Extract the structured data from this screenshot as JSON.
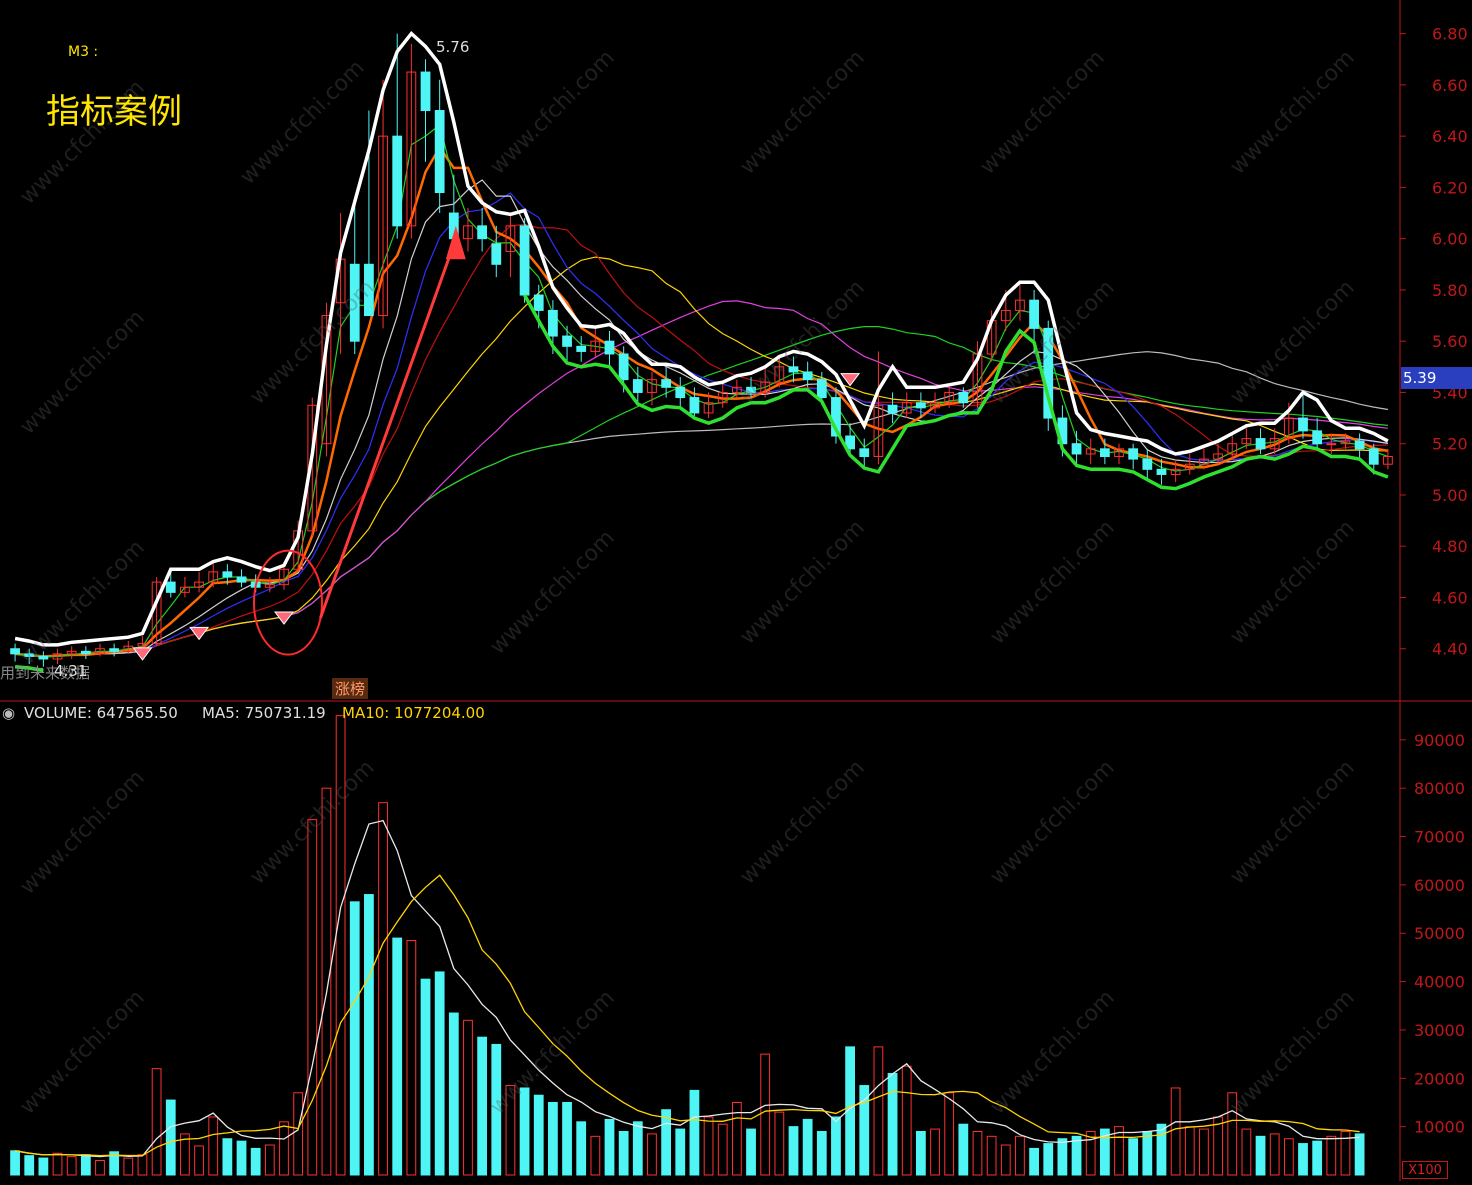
{
  "chart_title": "指标案例",
  "indicator_label": "M3 :",
  "peak_label": "5.76",
  "low_label": "4.31",
  "left_bottom_text": "用到未来数据",
  "event_tag": "涨榜",
  "current_price": "5.39",
  "volume_header": {
    "volume": "VOLUME: 647565.50",
    "ma5": "MA5: 750731.19",
    "ma10": "MA10: 1077204.00"
  },
  "volume_unit": "X100",
  "colors": {
    "up": "#ff3030",
    "down": "#4ff5f5",
    "axis": "#c01818",
    "ma_white": "#ffffff",
    "ma_yellow": "#ffd400",
    "ma_orange": "#ff6a00",
    "ma_blue": "#3030ff",
    "ma_magenta": "#e040e0",
    "ma_green": "#20d020",
    "ma_gray": "#bbbbbb",
    "ma_darkred": "#c01010"
  },
  "chart_data": [
    {
      "type": "candlestick",
      "name": "price",
      "ylim": [
        4.2,
        6.9
      ],
      "yticks": [
        "6.80",
        "6.60",
        "6.40",
        "6.20",
        "6.00",
        "5.80",
        "5.60",
        "5.40",
        "5.20",
        "5.00",
        "4.80",
        "4.60",
        "4.40"
      ],
      "candles": [
        [
          4.4,
          4.38,
          4.42,
          4.35
        ],
        [
          4.38,
          4.37,
          4.4,
          4.34
        ],
        [
          4.37,
          4.36,
          4.39,
          4.33
        ],
        [
          4.36,
          4.38,
          4.4,
          4.34
        ],
        [
          4.38,
          4.39,
          4.41,
          4.36
        ],
        [
          4.39,
          4.38,
          4.41,
          4.36
        ],
        [
          4.38,
          4.4,
          4.42,
          4.37
        ],
        [
          4.4,
          4.39,
          4.42,
          4.37
        ],
        [
          4.39,
          4.41,
          4.43,
          4.38
        ],
        [
          4.41,
          4.42,
          4.45,
          4.4
        ],
        [
          4.42,
          4.66,
          4.68,
          4.41
        ],
        [
          4.66,
          4.62,
          4.7,
          4.6
        ],
        [
          4.62,
          4.64,
          4.68,
          4.6
        ],
        [
          4.64,
          4.66,
          4.7,
          4.62
        ],
        [
          4.66,
          4.7,
          4.74,
          4.64
        ],
        [
          4.7,
          4.68,
          4.73,
          4.65
        ],
        [
          4.68,
          4.66,
          4.71,
          4.64
        ],
        [
          4.66,
          4.64,
          4.69,
          4.62
        ],
        [
          4.64,
          4.65,
          4.68,
          4.62
        ],
        [
          4.65,
          4.71,
          4.73,
          4.63
        ],
        [
          4.71,
          4.86,
          4.9,
          4.7
        ],
        [
          4.86,
          5.35,
          5.38,
          4.84
        ],
        [
          5.2,
          5.7,
          5.75,
          5.15
        ],
        [
          5.75,
          5.92,
          6.1,
          5.55
        ],
        [
          5.9,
          5.6,
          6.15,
          5.55
        ],
        [
          5.9,
          5.7,
          6.5,
          5.7
        ],
        [
          5.7,
          6.4,
          6.62,
          5.65
        ],
        [
          6.4,
          6.05,
          6.8,
          6.0
        ],
        [
          6.05,
          6.65,
          6.76,
          6.0
        ],
        [
          6.65,
          6.5,
          6.7,
          6.3
        ],
        [
          6.5,
          6.18,
          6.62,
          6.1
        ],
        [
          6.1,
          6.0,
          6.25,
          5.95
        ],
        [
          6.0,
          6.05,
          6.12,
          5.95
        ],
        [
          6.05,
          6.0,
          6.12,
          5.95
        ],
        [
          5.98,
          5.9,
          6.05,
          5.85
        ],
        [
          5.95,
          6.05,
          6.1,
          5.85
        ],
        [
          6.05,
          5.78,
          6.08,
          5.75
        ],
        [
          5.78,
          5.72,
          5.82,
          5.65
        ],
        [
          5.72,
          5.62,
          5.76,
          5.55
        ],
        [
          5.62,
          5.58,
          5.66,
          5.52
        ],
        [
          5.58,
          5.56,
          5.62,
          5.52
        ],
        [
          5.56,
          5.6,
          5.65,
          5.54
        ],
        [
          5.6,
          5.55,
          5.64,
          5.5
        ],
        [
          5.55,
          5.45,
          5.58,
          5.4
        ],
        [
          5.45,
          5.4,
          5.5,
          5.35
        ],
        [
          5.4,
          5.45,
          5.48,
          5.35
        ],
        [
          5.45,
          5.42,
          5.5,
          5.38
        ],
        [
          5.42,
          5.38,
          5.46,
          5.34
        ],
        [
          5.38,
          5.32,
          5.42,
          5.3
        ],
        [
          5.32,
          5.36,
          5.4,
          5.3
        ],
        [
          5.36,
          5.4,
          5.44,
          5.34
        ],
        [
          5.4,
          5.42,
          5.45,
          5.38
        ],
        [
          5.42,
          5.4,
          5.46,
          5.38
        ],
        [
          5.4,
          5.44,
          5.5,
          5.38
        ],
        [
          5.44,
          5.5,
          5.54,
          5.42
        ],
        [
          5.5,
          5.48,
          5.54,
          5.44
        ],
        [
          5.48,
          5.45,
          5.52,
          5.42
        ],
        [
          5.45,
          5.38,
          5.48,
          5.35
        ],
        [
          5.38,
          5.23,
          5.42,
          5.2
        ],
        [
          5.23,
          5.18,
          5.28,
          5.15
        ],
        [
          5.18,
          5.15,
          5.22,
          5.1
        ],
        [
          5.15,
          5.35,
          5.56,
          5.12
        ],
        [
          5.35,
          5.32,
          5.4,
          5.28
        ],
        [
          5.32,
          5.36,
          5.4,
          5.3
        ],
        [
          5.36,
          5.34,
          5.4,
          5.3
        ],
        [
          5.34,
          5.36,
          5.4,
          5.32
        ],
        [
          5.36,
          5.4,
          5.42,
          5.34
        ],
        [
          5.4,
          5.36,
          5.42,
          5.34
        ],
        [
          5.36,
          5.55,
          5.6,
          5.34
        ],
        [
          5.55,
          5.68,
          5.72,
          5.52
        ],
        [
          5.68,
          5.72,
          5.8,
          5.64
        ],
        [
          5.72,
          5.76,
          5.82,
          5.68
        ],
        [
          5.76,
          5.65,
          5.8,
          5.55
        ],
        [
          5.65,
          5.3,
          5.68,
          5.25
        ],
        [
          5.3,
          5.2,
          5.35,
          5.15
        ],
        [
          5.2,
          5.16,
          5.25,
          5.12
        ],
        [
          5.16,
          5.18,
          5.22,
          5.12
        ],
        [
          5.18,
          5.15,
          5.22,
          5.12
        ],
        [
          5.15,
          5.18,
          5.2,
          5.12
        ],
        [
          5.18,
          5.14,
          5.2,
          5.1
        ],
        [
          5.14,
          5.1,
          5.18,
          5.06
        ],
        [
          5.1,
          5.08,
          5.14,
          5.04
        ],
        [
          5.08,
          5.1,
          5.14,
          5.05
        ],
        [
          5.1,
          5.12,
          5.16,
          5.08
        ],
        [
          5.12,
          5.14,
          5.18,
          5.1
        ],
        [
          5.14,
          5.16,
          5.2,
          5.12
        ],
        [
          5.16,
          5.2,
          5.24,
          5.14
        ],
        [
          5.2,
          5.22,
          5.26,
          5.18
        ],
        [
          5.22,
          5.18,
          5.26,
          5.16
        ],
        [
          5.18,
          5.22,
          5.26,
          5.16
        ],
        [
          5.22,
          5.3,
          5.36,
          5.2
        ],
        [
          5.3,
          5.25,
          5.4,
          5.22
        ],
        [
          5.25,
          5.2,
          5.3,
          5.18
        ],
        [
          5.2,
          5.2,
          5.24,
          5.16
        ],
        [
          5.2,
          5.21,
          5.24,
          5.18
        ],
        [
          5.21,
          5.18,
          5.24,
          5.14
        ],
        [
          5.18,
          5.12,
          5.2,
          5.08
        ],
        [
          5.12,
          5.15,
          5.18,
          5.1
        ]
      ]
    },
    {
      "type": "bar",
      "name": "volume",
      "ylim": [
        0,
        97000
      ],
      "yticks": [
        "90000",
        "80000",
        "70000",
        "60000",
        "50000",
        "40000",
        "30000",
        "20000",
        "10000"
      ],
      "values": [
        5000,
        4000,
        3500,
        4500,
        3800,
        4200,
        3000,
        4800,
        3500,
        4200,
        22000,
        15500,
        8500,
        6000,
        12000,
        7500,
        7000,
        5500,
        6200,
        11000,
        17000,
        73500,
        80000,
        95000,
        56500,
        58000,
        77000,
        49000,
        48500,
        40500,
        42000,
        33500,
        32000,
        28500,
        27000,
        18500,
        18000,
        16500,
        15000,
        15000,
        11000,
        8000,
        11500,
        9000,
        11000,
        8500,
        13500,
        9500,
        17500,
        12000,
        10500,
        15000,
        9500,
        25000,
        13000,
        10000,
        11500,
        9000,
        12000,
        26500,
        18500,
        26500,
        21000,
        22500,
        9000,
        9500,
        17000,
        10500,
        9000,
        8000,
        6200,
        8000,
        5500,
        6500,
        7500,
        8000,
        9000,
        9500,
        10000,
        7500,
        9000,
        10500,
        18000,
        10000,
        9500,
        12000,
        17000,
        9500,
        8000,
        8500,
        7500,
        6500,
        7000,
        8000,
        9000,
        8500
      ]
    }
  ]
}
